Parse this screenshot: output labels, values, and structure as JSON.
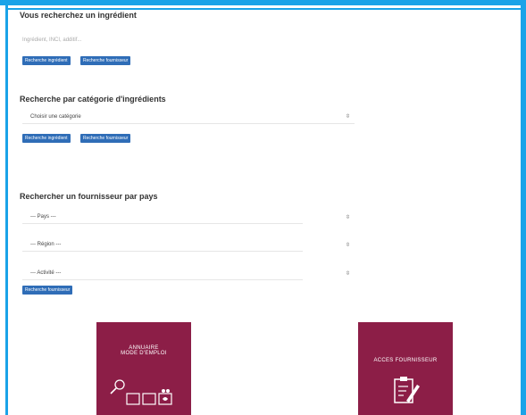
{
  "ingredient_search": {
    "title": "Vous recherchez un ingrédient",
    "placeholder": "Ingrédient, INCI, additif...",
    "btn_ingredient": "Recherche ingrédient",
    "btn_fournisseur": "Recherche fournisseur"
  },
  "category_search": {
    "title": "Recherche par catégorie d'ingrédients",
    "select_value": "Choisir une catégorie",
    "btn_ingredient": "Recherche ingrédient",
    "btn_fournisseur": "Recherche fournisseur"
  },
  "supplier_search": {
    "title": "Rechercher un fournisseur par pays",
    "pays": "--- Pays ---",
    "region": "--- Région ---",
    "activite": "--- Activité ---",
    "btn_fournisseur": "Recherche fournisseur"
  },
  "tiles": {
    "annuaire_line1": "ANNUAIRE",
    "annuaire_line2": "MODE D'EMPLOI",
    "acces": "ACCES FOURNISSEUR"
  },
  "colors": {
    "frame": "#1aa3e8",
    "button": "#2f6db7",
    "tile": "#8c1e47"
  },
  "icons": {
    "select_arrow": "sort-arrows-icon",
    "annuaire": "magnifier-boxes-icon",
    "acces": "clipboard-pen-icon"
  }
}
